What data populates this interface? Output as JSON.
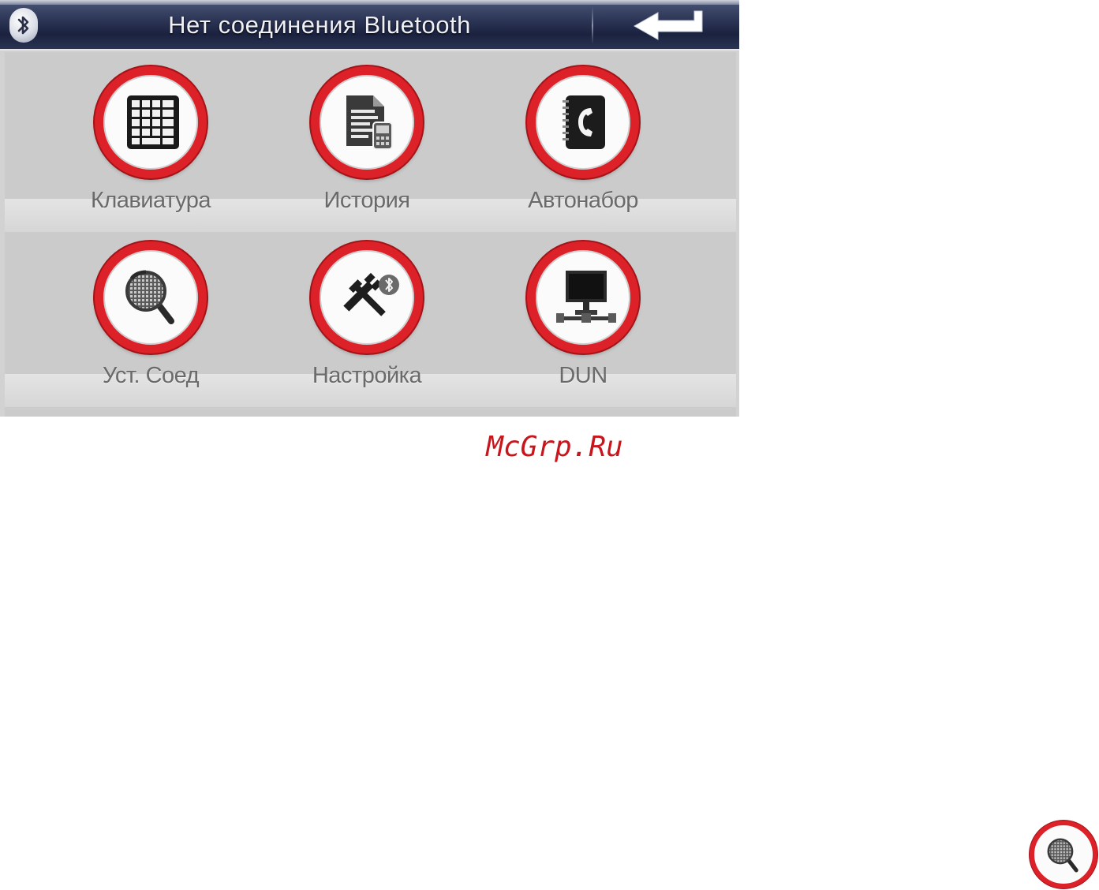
{
  "titlebar": {
    "title": "Нет соединения Bluetooth",
    "left_icon": "bluetooth-icon",
    "right_icon": "back-arrow-icon"
  },
  "menu": {
    "items": [
      {
        "label": "Клавиатура",
        "icon": "keypad-icon"
      },
      {
        "label": "История",
        "icon": "call-history-icon"
      },
      {
        "label": "Автонабор",
        "icon": "phonebook-icon"
      },
      {
        "label": "Уст. Соед",
        "icon": "device-search-icon"
      },
      {
        "label": "Настройка",
        "icon": "settings-tools-icon"
      },
      {
        "label": "DUN",
        "icon": "network-computer-icon"
      }
    ]
  },
  "watermark": {
    "text": "McGrp.Ru"
  },
  "colors": {
    "ring_red": "#dd2129",
    "titlebar_navy": "#1b2240",
    "panel_gray": "#cbcbcb",
    "label_gray": "#6a6a6a",
    "watermark_red": "#c8161d"
  }
}
